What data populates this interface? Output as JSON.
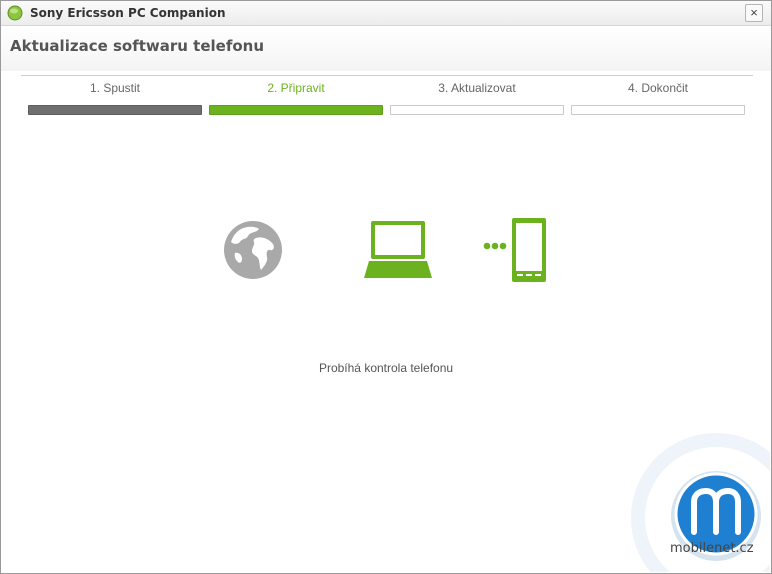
{
  "window": {
    "title": "Sony Ericsson PC Companion",
    "close_glyph": "×"
  },
  "header": {
    "title": "Aktualizace softwaru telefonu"
  },
  "steps": [
    {
      "label": "1. Spustit",
      "state": "done"
    },
    {
      "label": "2. Připravit",
      "state": "active"
    },
    {
      "label": "3. Aktualizovat",
      "state": "pending"
    },
    {
      "label": "4. Dokončit",
      "state": "pending"
    }
  ],
  "illustration": {
    "icons": [
      "globe-icon",
      "laptop-icon",
      "connection-dots-icon",
      "phone-icon"
    ],
    "colors": {
      "inactive": "#a9a9a9",
      "active": "#6cb21f"
    }
  },
  "status": {
    "message": "Probíhá kontrola telefonu"
  },
  "watermark": {
    "text": "mobilenet.cz",
    "logo_letter": "m"
  }
}
